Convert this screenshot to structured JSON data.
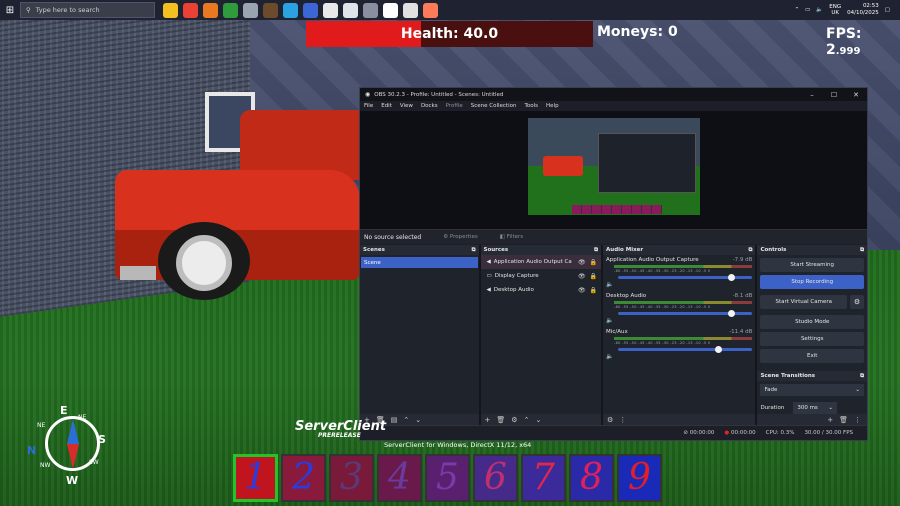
{
  "taskbar": {
    "search_placeholder": "Type here to search",
    "lang_top": "ENG",
    "lang_bottom": "UK",
    "time": "02:53",
    "date": "04/10/2025",
    "icon_colors": [
      "#f4c021",
      "#e94235",
      "#e97921",
      "#2e9c3d",
      "#9aa4b0",
      "#6b4b2b",
      "#2aa3e0",
      "#3a66d6",
      "#e8e8e8",
      "#dfe3ea",
      "#8a8fa0",
      "#ffffff",
      "#e0e0e0",
      "#ff7a59"
    ]
  },
  "hud": {
    "health_text": "Health: 40.0",
    "health_fraction": 0.4,
    "moneys_text": "Moneys: 0",
    "fps_label": "FPS: 2",
    "fps_decimal": ".999"
  },
  "obs": {
    "title": "OBS 30.2.3 - Profile: Untitled - Scenes: Untitled",
    "menu": [
      "File",
      "Edit",
      "View",
      "Docks",
      "Profile",
      "Scene Collection",
      "Tools",
      "Help"
    ],
    "no_source": "No source selected",
    "properties_btn": "Properties",
    "filters_btn": "Filters",
    "scenes": {
      "header": "Scenes",
      "items": [
        "Scene"
      ]
    },
    "sources": {
      "header": "Sources",
      "items": [
        "Application Audio Output Ca",
        "Display Capture",
        "Desktop Audio"
      ]
    },
    "mixer": {
      "header": "Audio Mixer",
      "ticks": "-60 -55 -50 -45 -40 -35 -30 -25 -20 -15 -10 -5 0",
      "channels": [
        {
          "name": "Application Audio Output Capture",
          "db": "-7.9 dB",
          "level": 0.82,
          "muted": true
        },
        {
          "name": "Desktop Audio",
          "db": "-8.1 dB",
          "level": 0.82,
          "muted": false
        },
        {
          "name": "Mic/Aux",
          "db": "-11.4 dB",
          "level": 0.72,
          "muted": true
        }
      ]
    },
    "controls": {
      "header": "Controls",
      "start_streaming": "Start Streaming",
      "stop_recording": "Stop Recording",
      "start_virtual_camera": "Start Virtual Camera",
      "studio_mode": "Studio Mode",
      "settings": "Settings",
      "exit": "Exit"
    },
    "transitions": {
      "header": "Scene Transitions",
      "selected": "Fade",
      "duration_label": "Duration",
      "duration_value": "300 ms"
    },
    "status": {
      "net_time": "00:00:00",
      "rec_time": "00:00:00",
      "cpu": "CPU: 0.3%",
      "fps": "30.00 / 30.00 FPS"
    }
  },
  "game": {
    "server_title": "ServerClient",
    "server_subtitle": "PRERELEASE",
    "client_info": "ServerClient for Windows, DirectX 11/12, x64",
    "compass": {
      "n": "N",
      "e": "E",
      "s": "S",
      "w": "W",
      "ne": "NE",
      "nw": "NW",
      "sw": "SW"
    },
    "hotbar": [
      {
        "label": "1",
        "color": "#2a3be0",
        "bg": "#c0141e"
      },
      {
        "label": "2",
        "color": "#2a3be0",
        "bg": "#8a1a3c"
      },
      {
        "label": "3",
        "color": "#5a3a7a",
        "bg": "#7a1a3a"
      },
      {
        "label": "4",
        "color": "#6a3aa0",
        "bg": "#6a1a4a"
      },
      {
        "label": "5",
        "color": "#7a3aa8",
        "bg": "#5a2070"
      },
      {
        "label": "6",
        "color": "#c03070",
        "bg": "#462a8a"
      },
      {
        "label": "7",
        "color": "#e0284a",
        "bg": "#3a2a9a"
      },
      {
        "label": "8",
        "color": "#e0205a",
        "bg": "#2a2aa8"
      },
      {
        "label": "9",
        "color": "#e01f2a",
        "bg": "#1a2ab8"
      }
    ]
  }
}
